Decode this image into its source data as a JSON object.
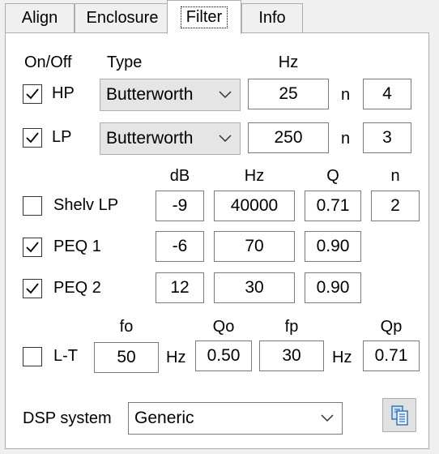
{
  "tabs": [
    "Align",
    "Enclosure",
    "Filter",
    "Info"
  ],
  "active_tab": "Filter",
  "filters": {
    "headers": {
      "onoff": "On/Off",
      "type": "Type",
      "hz": "Hz"
    },
    "rows": [
      {
        "label": "HP",
        "checked": true,
        "type": "Butterworth",
        "hz": "25",
        "n_label": "n",
        "n": "4"
      },
      {
        "label": "LP",
        "checked": true,
        "type": "Butterworth",
        "hz": "250",
        "n_label": "n",
        "n": "3"
      }
    ]
  },
  "eq": {
    "headers": {
      "db": "dB",
      "hz": "Hz",
      "q": "Q",
      "n": "n"
    },
    "rows": [
      {
        "label": "Shelv LP",
        "checked": false,
        "db": "-9",
        "hz": "40000",
        "q": "0.71",
        "n": "2"
      },
      {
        "label": "PEQ 1",
        "checked": true,
        "db": "-6",
        "hz": "70",
        "q": "0.90"
      },
      {
        "label": "PEQ 2",
        "checked": true,
        "db": "12",
        "hz": "30",
        "q": "0.90"
      }
    ]
  },
  "lt": {
    "headers": {
      "fo": "fo",
      "qo": "Qo",
      "fp": "fp",
      "qp": "Qp"
    },
    "label": "L-T",
    "checked": false,
    "fo": "50",
    "fo_unit": "Hz",
    "qo": "0.50",
    "fp": "30",
    "fp_unit": "Hz",
    "qp": "0.71"
  },
  "dsp": {
    "label": "DSP system",
    "value": "Generic",
    "copy_icon": "copy-icon"
  }
}
